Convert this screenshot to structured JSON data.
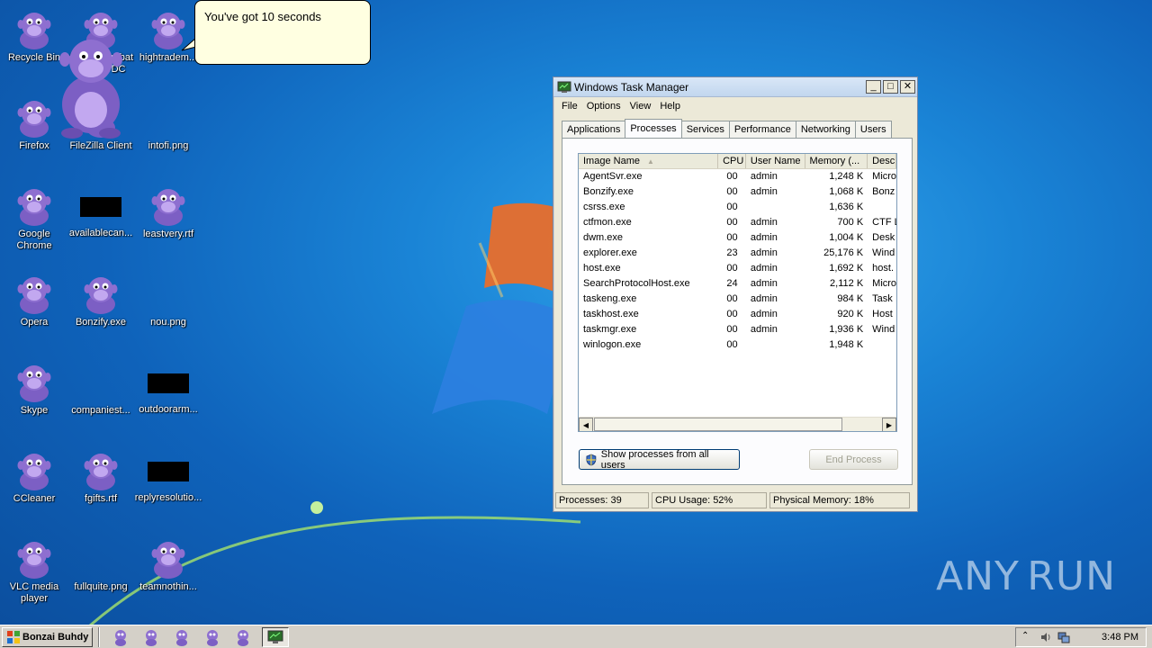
{
  "desktop": {
    "icons": [
      {
        "label": "Recycle Bin",
        "icon": "bonzi-icon"
      },
      {
        "label": "Adobe Acrobat Reader DC",
        "icon": "bonzi-icon"
      },
      {
        "label": "hightradem...",
        "icon": "bonzi-icon"
      },
      {
        "label": "Firefox",
        "icon": "bonzi-icon"
      },
      {
        "label": "FileZilla Client",
        "icon": "bonzi-icon"
      },
      {
        "label": "intofi.png",
        "icon": "blank"
      },
      {
        "label": "Google Chrome",
        "icon": "bonzi-icon"
      },
      {
        "label": "availablecan...",
        "icon": "black-thumbnail"
      },
      {
        "label": "leastvery.rtf",
        "icon": "bonzi-icon"
      },
      {
        "label": "Opera",
        "icon": "bonzi-icon"
      },
      {
        "label": "Bonzify.exe",
        "icon": "bonzi-icon"
      },
      {
        "label": "nou.png",
        "icon": "blank"
      },
      {
        "label": "Skype",
        "icon": "bonzi-icon"
      },
      {
        "label": "companiest...",
        "icon": "blank"
      },
      {
        "label": "outdoorarm...",
        "icon": "black-thumbnail"
      },
      {
        "label": "CCleaner",
        "icon": "bonzi-icon"
      },
      {
        "label": "fgifts.rtf",
        "icon": "bonzi-icon"
      },
      {
        "label": "replyresolutio...",
        "icon": "black-thumbnail"
      },
      {
        "label": "VLC media player",
        "icon": "bonzi-icon"
      },
      {
        "label": "fullquite.png",
        "icon": "blank"
      },
      {
        "label": "teamnothin...",
        "icon": "bonzi-icon"
      }
    ],
    "balloon_text": "You've got 10 seconds",
    "watermark": "ANY RUN"
  },
  "task_manager": {
    "title": "Windows Task Manager",
    "menu": [
      "File",
      "Options",
      "View",
      "Help"
    ],
    "tabs": [
      "Applications",
      "Processes",
      "Services",
      "Performance",
      "Networking",
      "Users"
    ],
    "active_tab": "Processes",
    "columns": [
      "Image Name",
      "CPU",
      "User Name",
      "Memory (...",
      "Desc"
    ],
    "rows": [
      [
        "AgentSvr.exe",
        "00",
        "admin",
        "1,248 K",
        "Micro"
      ],
      [
        "Bonzify.exe",
        "00",
        "admin",
        "1,068 K",
        "Bonz"
      ],
      [
        "csrss.exe",
        "00",
        "",
        "1,636 K",
        ""
      ],
      [
        "ctfmon.exe",
        "00",
        "admin",
        "700 K",
        "CTF L"
      ],
      [
        "dwm.exe",
        "00",
        "admin",
        "1,004 K",
        "Desk"
      ],
      [
        "explorer.exe",
        "23",
        "admin",
        "25,176 K",
        "Wind"
      ],
      [
        "host.exe",
        "00",
        "admin",
        "1,692 K",
        "host."
      ],
      [
        "SearchProtocolHost.exe",
        "24",
        "admin",
        "2,112 K",
        "Micro"
      ],
      [
        "taskeng.exe",
        "00",
        "admin",
        "984 K",
        "Task"
      ],
      [
        "taskhost.exe",
        "00",
        "admin",
        "920 K",
        "Host"
      ],
      [
        "taskmgr.exe",
        "00",
        "admin",
        "1,936 K",
        "Wind"
      ],
      [
        "winlogon.exe",
        "00",
        "",
        "1,948 K",
        ""
      ]
    ],
    "show_all_button": "Show processes from all users",
    "end_process_button": "End Process",
    "status": {
      "processes": "Processes: 39",
      "cpu": "CPU Usage: 52%",
      "memory": "Physical Memory: 18%"
    }
  },
  "taskbar": {
    "start_label": "Bonzai Buhdy",
    "clock": "3:48 PM"
  },
  "colors": {
    "desktop_blue": "#1a84d6",
    "bonzi_purple": "#8e6fd0",
    "balloon_bg": "#ffffe1",
    "window_bg": "#ece9d8"
  }
}
